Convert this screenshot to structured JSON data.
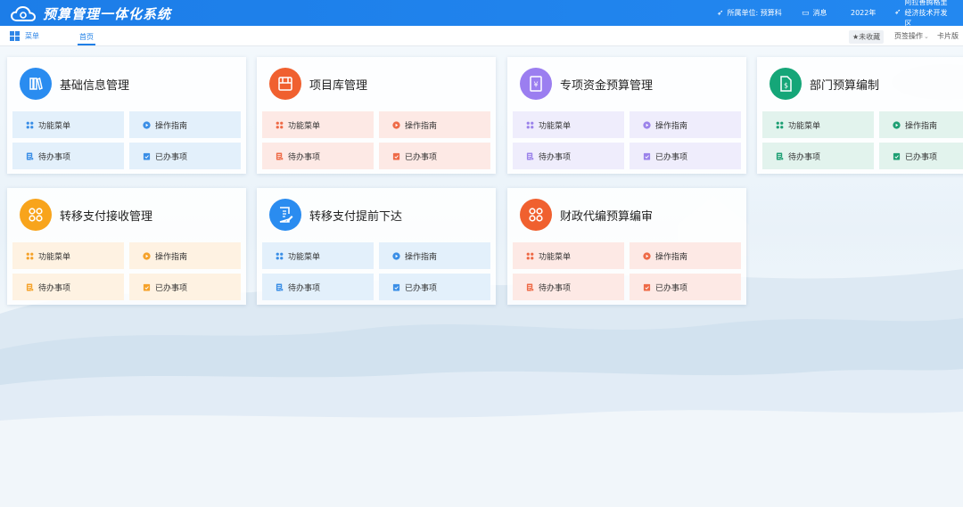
{
  "header": {
    "app_title": "预算管理一体化系统",
    "unit_label": "所属单位: 预算科",
    "messages_label": "消息",
    "year": "2022年",
    "org_name": "阿拉善腾格里经济技术开发区"
  },
  "tabbar": {
    "menu_label": "菜单",
    "home_tab": "首页",
    "favorite_label": "★未收藏",
    "page_ops_label": "页签操作",
    "view_label": "卡片版"
  },
  "cards": [
    {
      "title": "基础信息管理",
      "theme": "blue",
      "icon": "books-icon"
    },
    {
      "title": "项目库管理",
      "theme": "red",
      "icon": "project-box-icon"
    },
    {
      "title": "专项资金预算管理",
      "theme": "purple",
      "icon": "yuan-doc-icon"
    },
    {
      "title": "部门预算编制",
      "theme": "green",
      "icon": "money-doc-icon"
    },
    {
      "title": "转移支付接收管理",
      "theme": "orange",
      "icon": "apps-icon"
    },
    {
      "title": "转移支付提前下达",
      "theme": "blue",
      "icon": "edit-doc-icon"
    },
    {
      "title": "财政代编预算编审",
      "theme": "red",
      "icon": "apps-icon"
    }
  ],
  "card_buttons": {
    "menu": "功能菜单",
    "guide": "操作指南",
    "todo": "待办事项",
    "done": "已办事项"
  },
  "themes": {
    "blue": {
      "circle": "#2a8cf0",
      "bg": "#e3f0fb",
      "accent": "#3a8ee6"
    },
    "red": {
      "circle": "#f0602f",
      "bg": "#fde9e5",
      "accent": "#ee6a47"
    },
    "purple": {
      "circle": "#9b7ef0",
      "bg": "#efedfc",
      "accent": "#9b83ea"
    },
    "green": {
      "circle": "#15a678",
      "bg": "#e2f3ed",
      "accent": "#1d9f73"
    },
    "orange": {
      "circle": "#f8a41c",
      "bg": "#fef2e2",
      "accent": "#f5a22a"
    }
  }
}
